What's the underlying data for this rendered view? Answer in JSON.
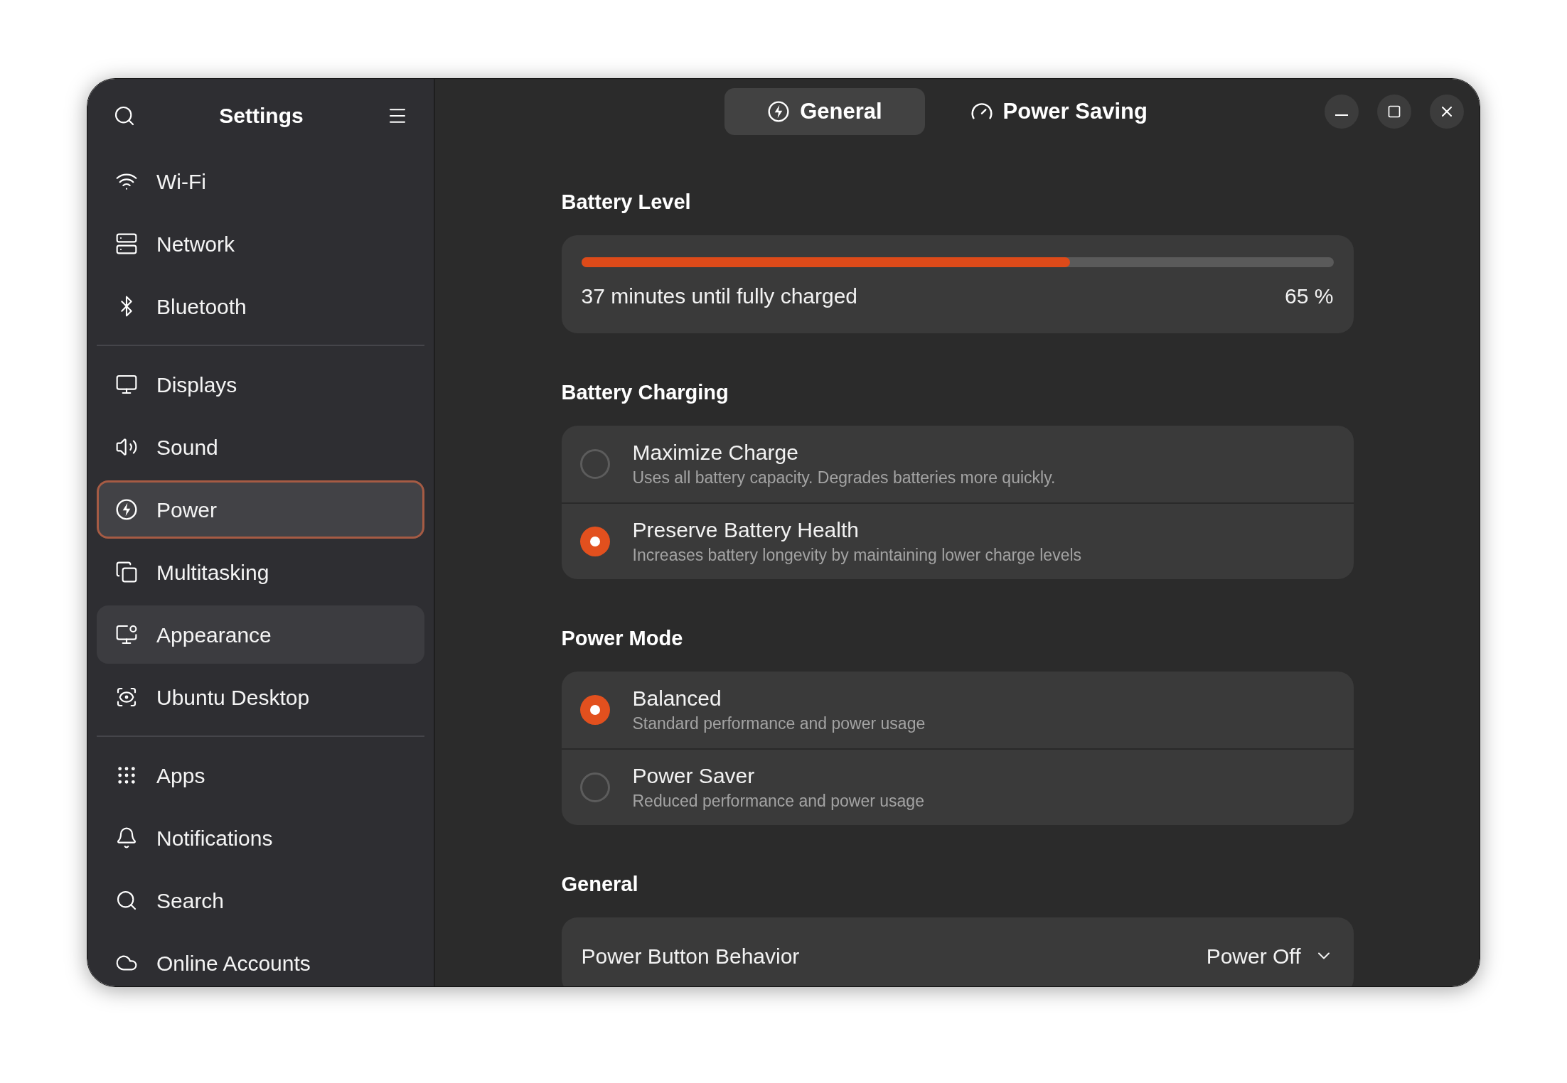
{
  "sidebar": {
    "title": "Settings",
    "groups": [
      {
        "items": [
          {
            "label": "Wi-Fi",
            "kind": "wifi",
            "selected": false,
            "hovered": false
          },
          {
            "label": "Network",
            "kind": "network",
            "selected": false,
            "hovered": false
          },
          {
            "label": "Bluetooth",
            "kind": "bluetooth",
            "selected": false,
            "hovered": false
          }
        ]
      },
      {
        "items": [
          {
            "label": "Displays",
            "kind": "display",
            "selected": false,
            "hovered": false
          },
          {
            "label": "Sound",
            "kind": "sound",
            "selected": false,
            "hovered": false
          },
          {
            "label": "Power",
            "kind": "power",
            "selected": true,
            "hovered": false
          },
          {
            "label": "Multitasking",
            "kind": "multitasking",
            "selected": false,
            "hovered": false
          },
          {
            "label": "Appearance",
            "kind": "appearance",
            "selected": false,
            "hovered": true
          },
          {
            "label": "Ubuntu Desktop",
            "kind": "desktop",
            "selected": false,
            "hovered": false
          }
        ]
      },
      {
        "items": [
          {
            "label": "Apps",
            "kind": "apps",
            "selected": false,
            "hovered": false
          },
          {
            "label": "Notifications",
            "kind": "notifications",
            "selected": false,
            "hovered": false
          },
          {
            "label": "Search",
            "kind": "search",
            "selected": false,
            "hovered": false
          },
          {
            "label": "Online Accounts",
            "kind": "cloud",
            "selected": false,
            "hovered": false
          }
        ]
      }
    ]
  },
  "tabs": [
    {
      "label": "General",
      "kind": "bolt",
      "selected": true
    },
    {
      "label": "Power Saving",
      "kind": "gauge",
      "selected": false
    }
  ],
  "battery_level": {
    "title": "Battery Level",
    "level": 0.65,
    "status": "37 minutes until fully charged",
    "percent": "65 %"
  },
  "battery_charging": {
    "title": "Battery Charging",
    "options": [
      {
        "title": "Maximize Charge",
        "subtitle": "Uses all battery capacity. Degrades batteries more quickly.",
        "selected": false
      },
      {
        "title": "Preserve Battery Health",
        "subtitle": "Increases battery longevity by maintaining lower charge levels",
        "selected": true
      }
    ]
  },
  "power_mode": {
    "title": "Power Mode",
    "options": [
      {
        "title": "Balanced",
        "subtitle": "Standard performance and power usage",
        "selected": true
      },
      {
        "title": "Power Saver",
        "subtitle": "Reduced performance and power usage",
        "selected": false
      }
    ]
  },
  "general": {
    "title": "General",
    "rows": [
      {
        "label": "Power Button Behavior",
        "value": "Power Off"
      }
    ]
  }
}
